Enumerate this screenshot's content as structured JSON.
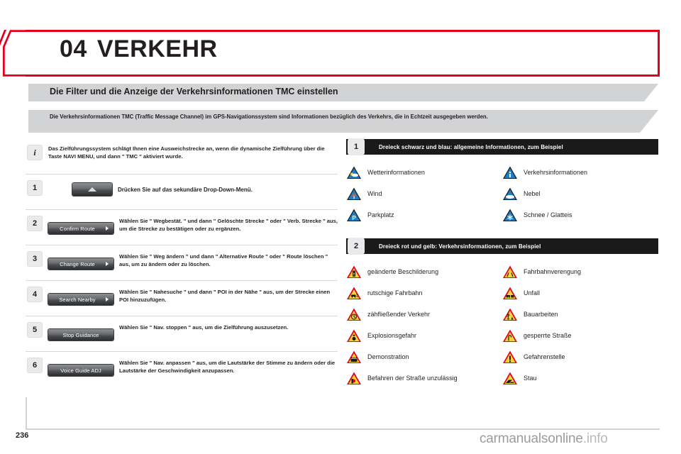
{
  "chapter": {
    "number": "04",
    "title": "VERKEHR",
    "accent_color": "#e2001a"
  },
  "section": {
    "title": "Die Filter und die Anzeige der Verkehrsinformationen TMC einstellen",
    "intro": "Die Verkehrsinformationen TMC (Traffic Message Channel) im GPS-Navigationssystem sind Informationen bezüglich des Verkehrs, die in Echtzeit ausgegeben werden.",
    "banner_color": "#d2d3d5"
  },
  "steps": [
    {
      "badge": "i",
      "button": null,
      "text": "Das Zielführungssystem schlägt Ihnen eine Ausweichstrecke an, wenn die dynamische Zielführung über die Taste NAVI MENU, und dann \" TMC \" aktiviert wurde."
    },
    {
      "badge": "1",
      "button": "",
      "button_icon": "up-arrow",
      "text": "Drücken Sie auf das sekundäre Drop-Down-Menü."
    },
    {
      "badge": "2",
      "button": "Confirm Route",
      "button_icon": "right-arrow",
      "text": "Wählen Sie \" Wegbestät. \" und dann \" Gelöschte Strecke \" oder \" Verb. Strecke \" aus, um die Strecke zu bestätigen oder zu ergänzen."
    },
    {
      "badge": "3",
      "button": "Change Route",
      "button_icon": "right-arrow",
      "text": "Wählen Sie \" Weg ändern \" und dann \" Alternative Route \" oder \" Route löschen \" aus, um zu ändern oder zu löschen."
    },
    {
      "badge": "4",
      "button": "Search Nearby",
      "button_icon": "right-arrow",
      "text": "Wählen Sie \" Nahesuche \" und dann \" POI in der Nähe \" aus, um der Strecke einen POI hinzuzufügen."
    },
    {
      "badge": "5",
      "button": "Stop Guidance",
      "button_icon": "none",
      "text": "Wählen Sie \" Nav. stoppen \" aus, um die Zielführung auszusetzen."
    },
    {
      "badge": "6",
      "button": "Voice Guide ADJ",
      "button_icon": "none",
      "text": "Wählen Sie \" Nav. anpassen \" aus, um die Lautstärke der Stimme zu ändern oder die Lautstärke der Geschwindigkeit anzupassen."
    }
  ],
  "legend_sections": [
    {
      "badge": "1",
      "title": "Dreieck schwarz und blau: allgemeine Informationen, zum Beispiel",
      "style": "blue",
      "items": [
        {
          "label": "Wetterinformationen",
          "icon": "weather-sun-cloud-icon"
        },
        {
          "label": "Verkehrsinformationen",
          "icon": "info-i-icon"
        },
        {
          "label": "Wind",
          "icon": "wind-arrow-icon"
        },
        {
          "label": "Nebel",
          "icon": "fog-icon"
        },
        {
          "label": "Parkplatz",
          "icon": "parking-p-icon"
        },
        {
          "label": "Schnee / Glatteis",
          "icon": "snowflake-icon"
        }
      ]
    },
    {
      "badge": "2",
      "title": "Dreieck rot und gelb: Verkehrsinformationen, zum Beispiel",
      "style": "redyellow",
      "items": [
        {
          "label": "geänderte Beschilderung",
          "icon": "traffic-light-icon"
        },
        {
          "label": "Fahrbahnverengung",
          "icon": "road-narrows-icon"
        },
        {
          "label": "rutschige Fahrbahn",
          "icon": "slippery-road-icon"
        },
        {
          "label": "Unfall",
          "icon": "accident-icon"
        },
        {
          "label": "zähfließender Verkehr",
          "icon": "slow-traffic-icon"
        },
        {
          "label": "Bauarbeiten",
          "icon": "roadworks-icon"
        },
        {
          "label": "Explosionsgefahr",
          "icon": "explosion-icon"
        },
        {
          "label": "gesperrte Straße",
          "icon": "closed-road-icon"
        },
        {
          "label": "Demonstration",
          "icon": "demonstration-icon"
        },
        {
          "label": "Gefahrenstelle",
          "icon": "exclamation-icon"
        },
        {
          "label": "Befahren der Straße unzulässig",
          "icon": "no-entry-icon"
        },
        {
          "label": "Stau",
          "icon": "congestion-icon"
        }
      ]
    }
  ],
  "footer": {
    "page_number": "236",
    "watermark": "carmanualsonline",
    "watermark_suffix": ".info"
  }
}
